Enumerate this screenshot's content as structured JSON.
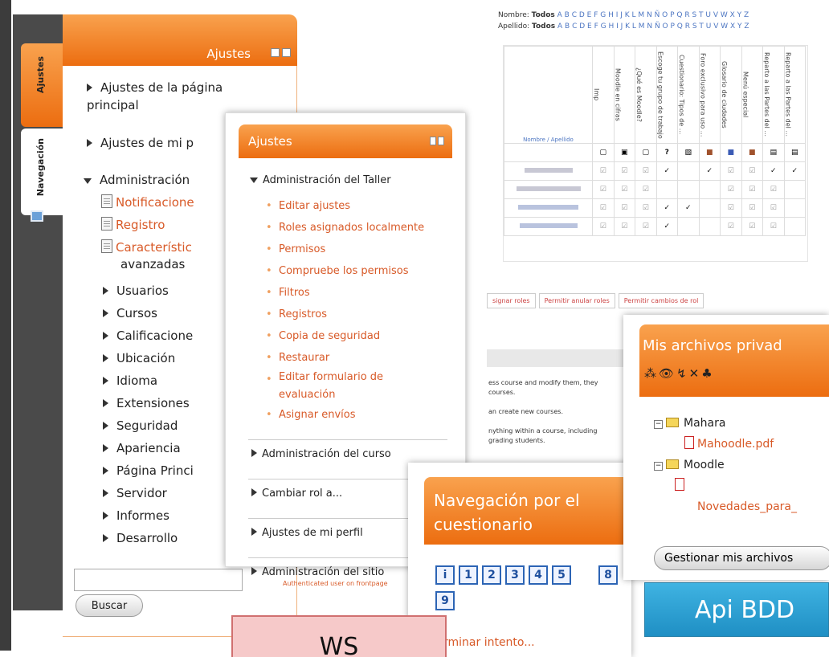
{
  "panel1": {
    "title": "Ajustes",
    "side_tabs": [
      "Ajustes",
      "Navegación"
    ],
    "sections": [
      "Ajustes de la página principal",
      "Ajustes de mi p",
      "Administración"
    ],
    "admin_links": [
      "Notificacione",
      "Registro",
      "Característic",
      "avanzadas"
    ],
    "admin_items": [
      "Usuarios",
      "Cursos",
      "Calificacione",
      "Ubicación",
      "Idioma",
      "Extensiones",
      "Seguridad",
      "Apariencia",
      "Página Princi",
      "Servidor",
      "Informes",
      "Desarrollo"
    ],
    "search_button": "Buscar"
  },
  "panel2": {
    "title": "Ajustes",
    "section": "Administración del Taller",
    "items": [
      "Editar ajustes",
      "Roles asignados localmente",
      "Permisos",
      "Compruebe los permisos",
      "Filtros",
      "Registros",
      "Copia de seguridad",
      "Restaurar",
      "Editar formulario de evaluación",
      "Asignar envíos"
    ],
    "bottom": [
      "Administración del curso",
      "Cambiar rol a...",
      "Ajustes de mi perfil",
      "Administración del sitio"
    ]
  },
  "table": {
    "filter_first_label": "Nombre:",
    "filter_last_label": "Apellido:",
    "filter_all": "Todos",
    "letters": "A B C D E F G H I J K L M N Ñ O P Q R S T U V W X Y Z",
    "col_header_name": "Nombre / Apellido",
    "columns": [
      "Imp",
      "Moodle en cifras",
      "¿Qué es Moodle?",
      "Escoge tu grupo de trabajo",
      "Cuestionario: Tipos de ...",
      "Foro exclusivo para uso ...",
      "Glosario de ciudades",
      "Menú especial",
      "Reparto a las Partes del ...",
      "Reparto a las Partes del ..."
    ]
  },
  "roles_panel": {
    "tabs": [
      "signar roles",
      "Permitir anular roles",
      "Permitir cambios de rol"
    ],
    "texts": [
      "ess course and modify them, they",
      "courses.",
      "an create new courses.",
      "nything within a course, including",
      "grading students."
    ],
    "footer": "Authenticated user on frontpage"
  },
  "quiz": {
    "title": "Navegación por el cuestionario",
    "buttons": [
      "i",
      "1",
      "2",
      "3",
      "4",
      "5",
      "8",
      "9"
    ],
    "finish": "rminar intento..."
  },
  "files": {
    "title": "Mis archivos privad",
    "tree": [
      "Mahara",
      "Mahoodle.pdf",
      "Moodle",
      "Novedades_para_"
    ],
    "manage_button": "Gestionar mis archivos"
  },
  "overlays": {
    "ws": "WS",
    "api": "Api BDD"
  },
  "colors": {
    "accent": "#ef7d22",
    "link": "#d85a28",
    "ws_bg": "#f6c9c9",
    "api_bg": "#29a3d6"
  }
}
